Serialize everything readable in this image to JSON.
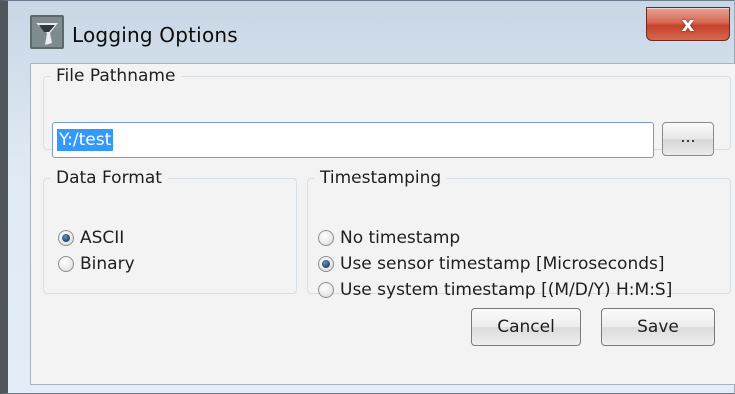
{
  "window": {
    "title": "Logging Options",
    "close_glyph": "x",
    "icon": "app-icon"
  },
  "file_group": {
    "legend": "File Pathname",
    "path_value": "Y:/test",
    "browse_label": "..."
  },
  "format_group": {
    "legend": "Data Format",
    "options": [
      {
        "label": "ASCII",
        "checked": true
      },
      {
        "label": "Binary",
        "checked": false
      }
    ]
  },
  "time_group": {
    "legend": "Timestamping",
    "options": [
      {
        "label": "No timestamp",
        "checked": false
      },
      {
        "label": "Use sensor timestamp [Microseconds]",
        "checked": true
      },
      {
        "label": "Use system timestamp [(M/D/Y) H:M:S]",
        "checked": false
      }
    ]
  },
  "buttons": {
    "cancel_label": "Cancel",
    "save_label": "Save"
  },
  "colors": {
    "selection": "#3399ff",
    "close_button": "#c6412a"
  }
}
